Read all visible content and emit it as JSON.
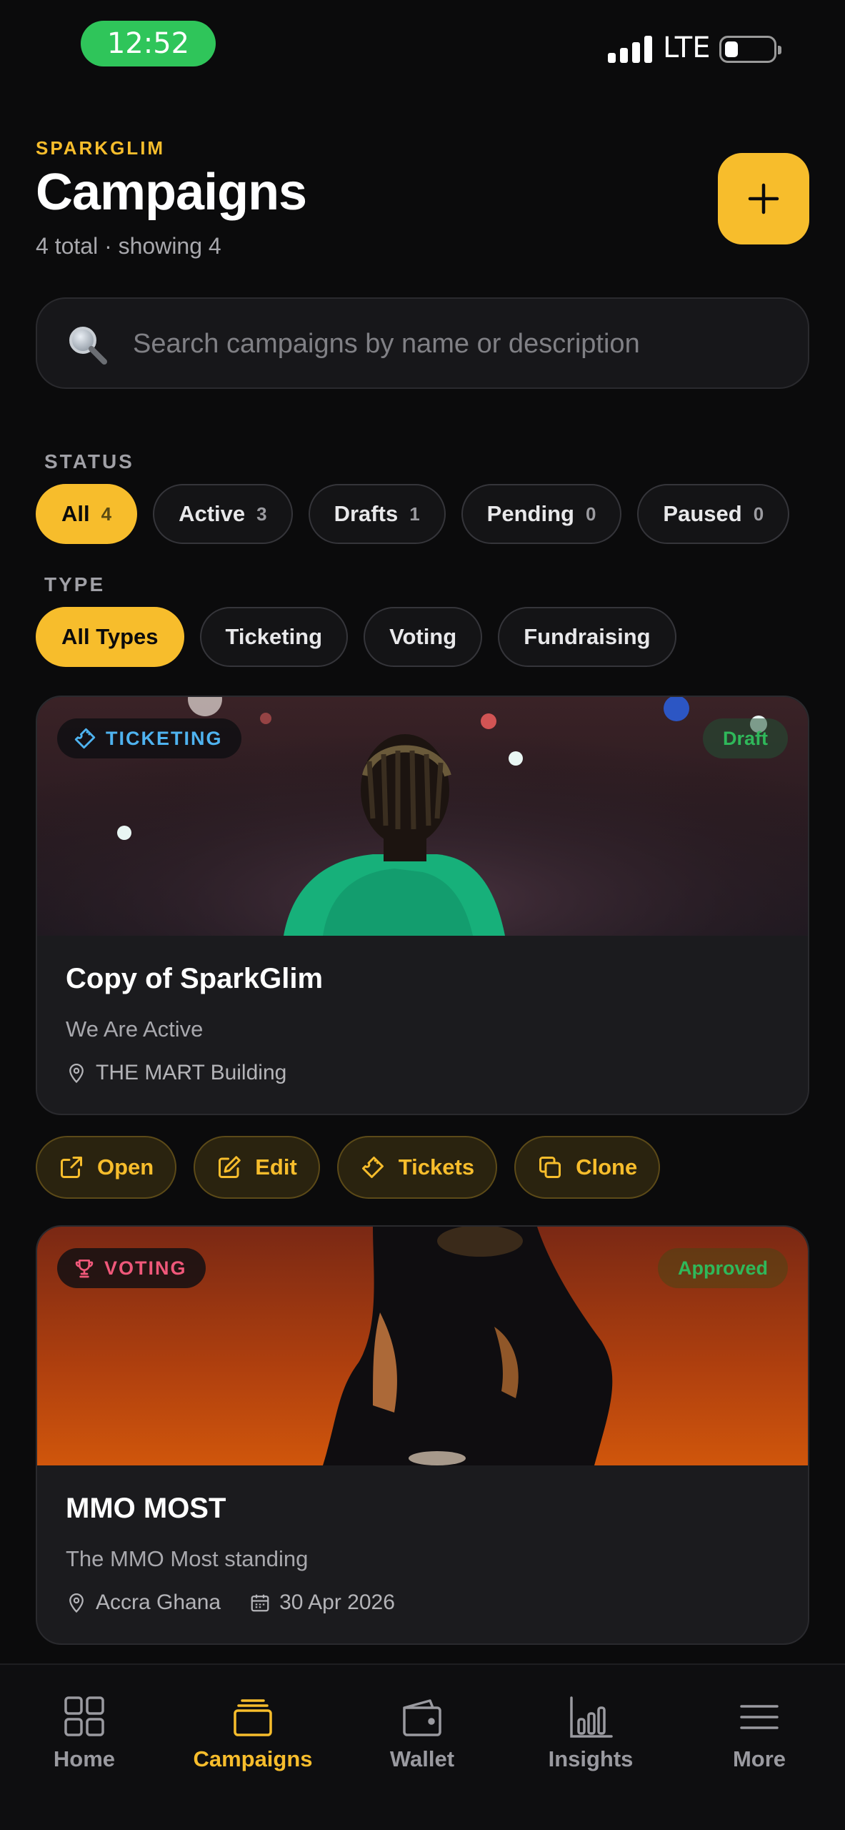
{
  "status_bar": {
    "time": "12:52",
    "network": "LTE"
  },
  "header": {
    "brand": "SPARKGLIM",
    "title": "Campaigns",
    "subtitle": "4 total · showing 4",
    "add_icon": "plus-icon"
  },
  "search": {
    "placeholder": "Search campaigns by name or description",
    "value": "",
    "icon": "search-icon"
  },
  "filters": {
    "status_label": "STATUS",
    "status_chips": [
      {
        "label": "All",
        "count": "4",
        "selected": true
      },
      {
        "label": "Active",
        "count": "3",
        "selected": false
      },
      {
        "label": "Drafts",
        "count": "1",
        "selected": false
      },
      {
        "label": "Pending",
        "count": "0",
        "selected": false
      },
      {
        "label": "Paused",
        "count": "0",
        "selected": false
      }
    ],
    "type_label": "TYPE",
    "type_chips": [
      {
        "label": "All Types",
        "selected": true
      },
      {
        "label": "Ticketing",
        "selected": false
      },
      {
        "label": "Voting",
        "selected": false
      },
      {
        "label": "Fundraising",
        "selected": false
      }
    ]
  },
  "campaigns": [
    {
      "type": "TICKETING",
      "type_icon": "ticket-icon",
      "type_color": "#4fb3f0",
      "status": "Draft",
      "status_color": "#2fb85a",
      "title": "Copy of SparkGlim",
      "description": "We Are Active",
      "location": "THE MART Building",
      "date": ""
    },
    {
      "type": "VOTING",
      "type_icon": "trophy-icon",
      "type_color": "#f0587a",
      "status": "Approved",
      "status_color": "#2fb85a",
      "title": "MMO MOST",
      "description": "The MMO Most standing",
      "location": "Accra Ghana",
      "date": "30 Apr 2026"
    }
  ],
  "card_actions": [
    {
      "label": "Open",
      "icon": "external-link-icon"
    },
    {
      "label": "Edit",
      "icon": "edit-icon"
    },
    {
      "label": "Tickets",
      "icon": "ticket-icon"
    },
    {
      "label": "Clone",
      "icon": "copy-icon"
    }
  ],
  "nav": {
    "items": [
      {
        "label": "Home",
        "icon": "grid-icon",
        "active": false
      },
      {
        "label": "Campaigns",
        "icon": "stack-icon",
        "active": true
      },
      {
        "label": "Wallet",
        "icon": "wallet-icon",
        "active": false
      },
      {
        "label": "Insights",
        "icon": "bar-chart-icon",
        "active": false
      },
      {
        "label": "More",
        "icon": "menu-icon",
        "active": false
      }
    ]
  },
  "colors": {
    "accent": "#f7bd2c",
    "background": "#0b0b0c",
    "card": "#1b1b1e"
  }
}
